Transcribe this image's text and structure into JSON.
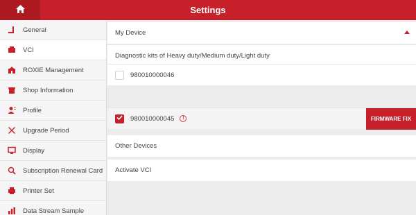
{
  "header": {
    "title": "Settings",
    "home_icon": "home-icon",
    "accent": "#c8202a"
  },
  "sidebar": {
    "items": [
      {
        "label": "General",
        "icon": "general-icon",
        "active": false
      },
      {
        "label": "VCI",
        "icon": "vci-icon",
        "active": true
      },
      {
        "label": "ROXIE Management",
        "icon": "roxie-icon",
        "active": false
      },
      {
        "label": "Shop Information",
        "icon": "shop-icon",
        "active": false
      },
      {
        "label": "Profile",
        "icon": "profile-icon",
        "active": false
      },
      {
        "label": "Upgrade Period",
        "icon": "upgrade-icon",
        "active": false
      },
      {
        "label": "Display",
        "icon": "display-icon",
        "active": false
      },
      {
        "label": "Subscription Renewal Card",
        "icon": "search-icon",
        "active": false
      },
      {
        "label": "Printer Set",
        "icon": "printer-icon",
        "active": false
      },
      {
        "label": "Data Stream Sample",
        "icon": "data-stream-icon",
        "active": false
      }
    ]
  },
  "main": {
    "my_device_label": "My Device",
    "diag_kits_label": "Diagnostic kits of Heavy duty/Medium duty/Light duty",
    "devices": [
      {
        "serial": "980010000046",
        "checked": false
      },
      {
        "serial": "980010000045",
        "checked": true
      }
    ],
    "firmware_fix_label": "FIRMWARE FIX",
    "other_devices_label": "Other Devices",
    "activate_vci_label": "Activate VCI"
  }
}
